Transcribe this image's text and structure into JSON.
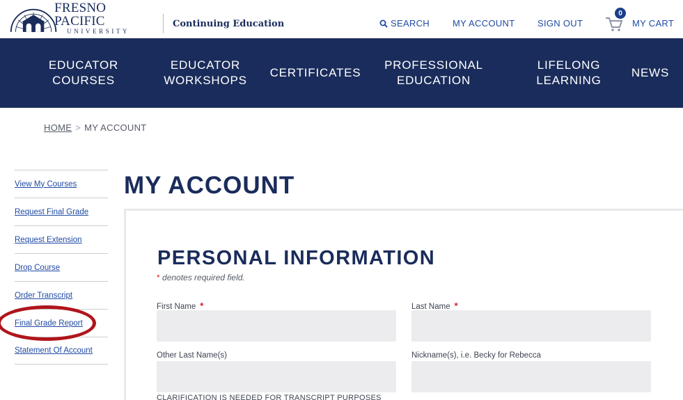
{
  "header": {
    "logo_name": "FRESNO PACIFIC",
    "logo_sub": "UNIVERSITY",
    "section_label": "Continuing Education",
    "search_label": "SEARCH",
    "my_account_label": "MY ACCOUNT",
    "sign_out_label": "SIGN OUT",
    "cart_count": "0",
    "cart_label": "MY CART"
  },
  "nav": {
    "items": [
      {
        "label": "EDUCATOR COURSES"
      },
      {
        "label": "EDUCATOR WORKSHOPS"
      },
      {
        "label": "CERTIFICATES"
      },
      {
        "label": "PROFESSIONAL EDUCATION"
      },
      {
        "label": "LIFELONG LEARNING"
      },
      {
        "label": "NEWS"
      }
    ]
  },
  "breadcrumb": {
    "home": "HOME",
    "separator": ">",
    "current": "MY ACCOUNT"
  },
  "sidebar": {
    "items": [
      {
        "label": "View My Courses"
      },
      {
        "label": "Request Final Grade"
      },
      {
        "label": "Request Extension"
      },
      {
        "label": "Drop Course"
      },
      {
        "label": "Order Transcript"
      },
      {
        "label": "Final Grade Report"
      },
      {
        "label": "Statement Of Account"
      }
    ]
  },
  "main": {
    "page_title": "MY ACCOUNT",
    "section_title": "PERSONAL INFORMATION",
    "required_star": "*",
    "required_note": "denotes required field.",
    "fields": [
      {
        "label": "First Name",
        "required": "*",
        "value": ""
      },
      {
        "label": "Last Name",
        "required": "*",
        "value": ""
      },
      {
        "label": "Other Last Name(s)",
        "value": ""
      },
      {
        "label": "Nickname(s), i.e. Becky for Rebecca",
        "value": ""
      }
    ],
    "clarification": "CLARIFICATION IS NEEDED FOR TRANSCRIPT PURPOSES"
  },
  "colors": {
    "nav_background": "#1a2c5b",
    "link_blue": "#1f4aa3",
    "required_red": "#d81b2c",
    "annotation_ring": "#b0151c",
    "input_background": "#ececee"
  }
}
